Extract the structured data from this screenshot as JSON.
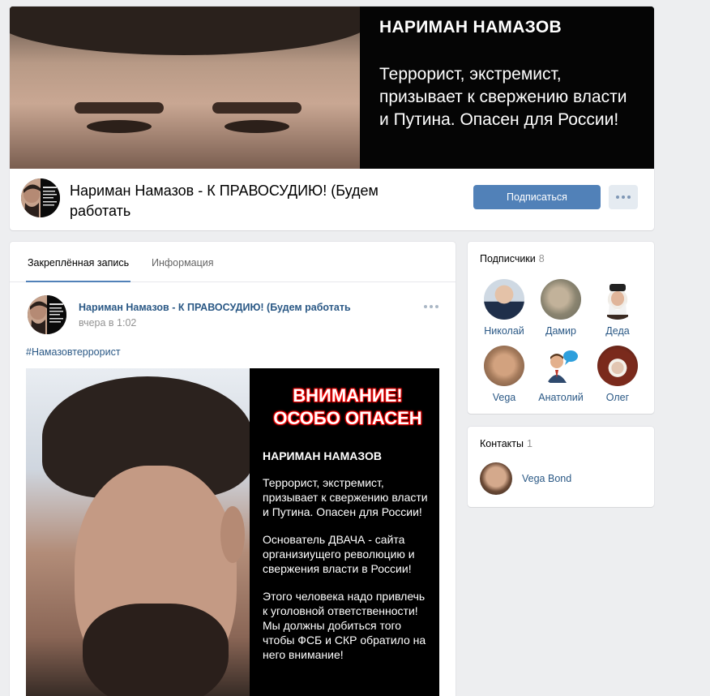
{
  "header": {
    "cover_title": "НАРИМАН НАМАЗОВ",
    "cover_text": "Террорист, экстремист, призывает к свержению власти и Путина. Опасен для России!",
    "page_name": "Нариман Намазов - К ПРАВОСУДИЮ! (Будем работать",
    "subscribe_label": "Подписаться"
  },
  "tabs": [
    {
      "label": "Закреплённая запись",
      "active": true
    },
    {
      "label": "Информация",
      "active": false
    }
  ],
  "post": {
    "author": "Нариман Намазов - К ПРАВОСУДИЮ! (Будем работать",
    "time": "вчера в 1:02",
    "hashtag": "#Намазовтеррорист",
    "image": {
      "warning_line1": "ВНИМАНИЕ!",
      "warning_line2": "ОСОБО ОПАСЕН",
      "name": "НАРИМАН НАМАЗОВ",
      "para1": "Террорист, экстремист, призывает к свержению власти и Путина. Опасен для России!",
      "para2": "Основатель ДВАЧА - сайта организиущего революцию и свержения власти в России!",
      "para3": "Этого человека надо привлечь к уголовной ответственности! Мы должны добиться того чтобы ФСБ и СКР обратило на него внимание!"
    }
  },
  "followers": {
    "title": "Подписчики",
    "count": "8",
    "items": [
      {
        "name": "Николай"
      },
      {
        "name": "Дамир"
      },
      {
        "name": "Деда"
      },
      {
        "name": "Vega"
      },
      {
        "name": "Анатолий"
      },
      {
        "name": "Олег"
      }
    ]
  },
  "contacts": {
    "title": "Контакты",
    "count": "1",
    "items": [
      {
        "name": "Vega Bond"
      }
    ]
  },
  "colors": {
    "accent": "#5181b8",
    "link": "#2a5885",
    "background": "#edeef0"
  }
}
